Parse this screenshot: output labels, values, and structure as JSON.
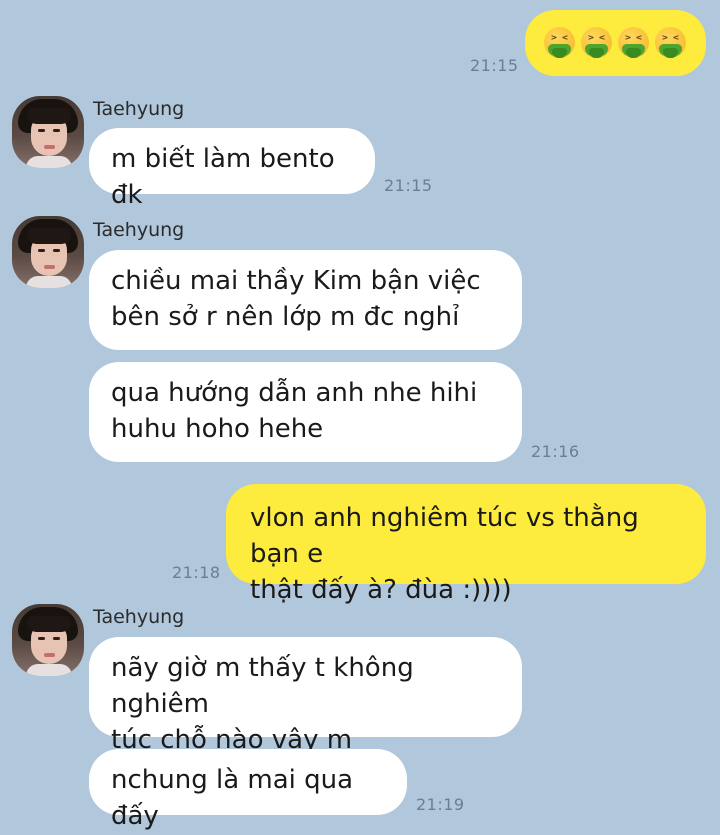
{
  "theme": {
    "background": "#b1c7db",
    "incoming_bubble": "#ffffff",
    "outgoing_bubble": "#fdeb3e"
  },
  "messages": [
    {
      "side": "outgoing",
      "type": "emoji",
      "icon": "nauseated-face-icon",
      "count": 4,
      "time": "21:15"
    },
    {
      "side": "incoming",
      "sender": "Taehyung",
      "text": "m biết làm bento đk",
      "time": "21:15"
    },
    {
      "side": "incoming",
      "sender": "Taehyung",
      "text": "chiều mai thầy Kim bận việc\nbên sở r nên lớp m đc nghỉ"
    },
    {
      "side": "incoming",
      "text": "qua hướng dẫn anh nhe hihi\nhuhu hoho hehe",
      "time": "21:16"
    },
    {
      "side": "outgoing",
      "text": "vlon anh nghiêm túc vs thằng bạn e\nthật đấy à? đùa :))))",
      "time": "21:18"
    },
    {
      "side": "incoming",
      "sender": "Taehyung",
      "text": "nãy giờ m thấy t không nghiêm\ntúc chỗ nào vậy m"
    },
    {
      "side": "incoming",
      "text": "nchung là mai qua đấy",
      "time": "21:19"
    }
  ]
}
